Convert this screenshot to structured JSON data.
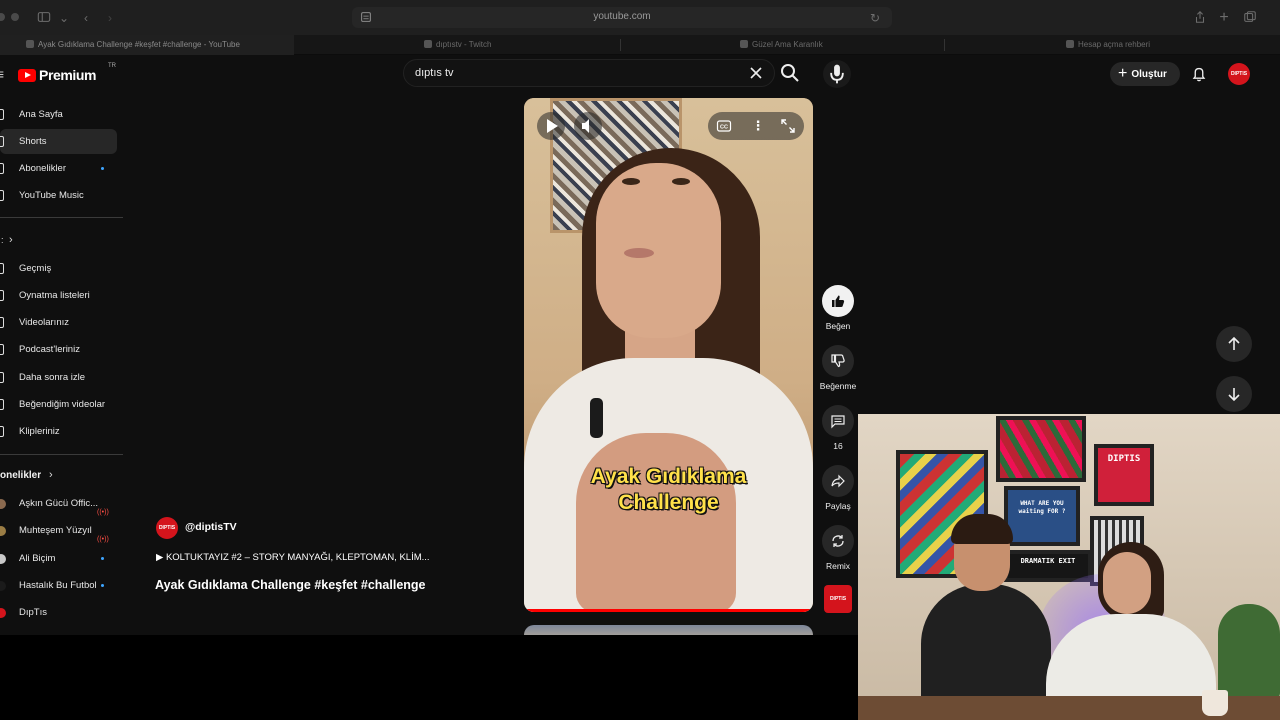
{
  "browser": {
    "url": "youtube.com",
    "tabs": [
      {
        "label": "Ayak Gıdıklama Challenge #keşfet #challenge - YouTube",
        "active": true
      },
      {
        "label": "dıptıstv - Twitch",
        "active": false
      },
      {
        "label": "Güzel Ama Karanlık",
        "active": false
      },
      {
        "label": "Hesap açma rehberi",
        "active": false
      }
    ]
  },
  "header": {
    "logo_text": "Premium",
    "logo_sup": "TR",
    "search_value": "dıptıs tv",
    "create_label": "Oluştur",
    "avatar_text": "DIPTIS"
  },
  "sidebar": {
    "main": [
      {
        "label": "Ana Sayfa",
        "icon": "home-icon"
      },
      {
        "label": "Shorts",
        "icon": "shorts-icon",
        "active": true
      },
      {
        "label": "Abonelikler",
        "icon": "subscriptions-icon",
        "dot": true
      },
      {
        "label": "YouTube Music",
        "icon": "music-icon"
      }
    ],
    "you": [
      {
        "label": "Geçmiş",
        "icon": "history-icon"
      },
      {
        "label": "Oynatma listeleri",
        "icon": "playlists-icon"
      },
      {
        "label": "Videolarınız",
        "icon": "videos-icon"
      },
      {
        "label": "Podcast'leriniz",
        "icon": "podcast-icon"
      },
      {
        "label": "Daha sonra izle",
        "icon": "watch-later-icon"
      },
      {
        "label": "Beğendiğim videolar",
        "icon": "liked-icon"
      },
      {
        "label": "Klipleriniz",
        "icon": "clips-icon"
      }
    ],
    "subscriptions_heading": "onelikler",
    "subscriptions": [
      {
        "label": "Aşkın Gücü Offic...",
        "badge": "live"
      },
      {
        "label": "Muhteşem Yüzyıl",
        "badge": "live"
      },
      {
        "label": "Ali Biçim",
        "badge": "dot"
      },
      {
        "label": "Hastalık Bu Futbol",
        "badge": "dot"
      },
      {
        "label": "DıpTıs",
        "badge": ""
      }
    ]
  },
  "short": {
    "caption_line1": "Ayak Gıdıklama",
    "caption_line2": "Challenge",
    "channel_handle": "@diptisTV",
    "channel_avatar_text": "DIPTIS",
    "playlist_line": "▶ KOLTUKTAYIZ #2 – STORY MANYAĞI, KLEPTOMAN, KLİM...",
    "title": "Ayak Gıdıklama Challenge #keşfet #challenge",
    "progress": 1.0
  },
  "actions": {
    "like_label": "Beğen",
    "dislike_label": "Beğenme",
    "comments_count": "16",
    "share_label": "Paylaş",
    "remix_label": "Remix",
    "channel_thumb_text": "DIPTIS"
  },
  "webcam": {
    "sign_1": "DIPTIS",
    "sign_2": "WHAT ARE YOU waiting FOR ?",
    "sign_3": "DRAMATIK EXIT"
  },
  "colors": {
    "accent": "#ff0000",
    "brand_red": "#d4141c",
    "caption": "#ffe14a"
  }
}
